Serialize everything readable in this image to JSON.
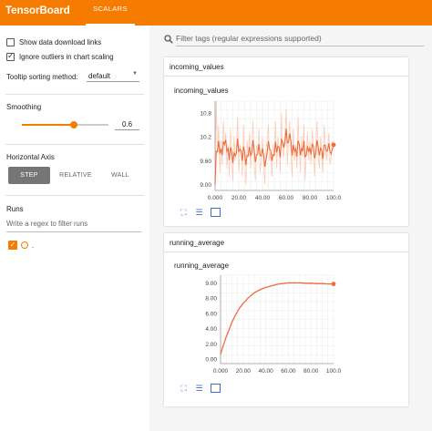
{
  "header": {
    "brand": "TensorBoard",
    "tabs": [
      {
        "label": "SCALARS",
        "active": true
      }
    ]
  },
  "sidebar": {
    "show_download": {
      "label": "Show data download links",
      "checked": false
    },
    "ignore_outliers": {
      "label": "Ignore outliers in chart scaling",
      "checked": true
    },
    "tooltip_sort": {
      "label": "Tooltip sorting method:",
      "value": "default"
    },
    "smoothing": {
      "title": "Smoothing",
      "value": "0.6",
      "fraction": 0.6
    },
    "horizontal_axis": {
      "title": "Horizontal Axis",
      "options": [
        "STEP",
        "RELATIVE",
        "WALL"
      ],
      "selected": "STEP"
    },
    "runs": {
      "title": "Runs",
      "placeholder": "Write a regex to filter runs",
      "items": [
        {
          "name": ".",
          "checked": true
        }
      ]
    }
  },
  "main": {
    "filter_placeholder": "Filter tags (regular expressions supported)"
  },
  "colors": {
    "accent": "#f57c00",
    "line": "#f26b38",
    "line_raw": "#f9b89a"
  },
  "icons": [
    "search-icon",
    "fit-domain-icon",
    "log-scale-icon",
    "expand-icon"
  ],
  "chart_data": [
    {
      "type": "line",
      "card_title": "incoming_values",
      "title": "incoming_values",
      "xlim": [
        0,
        100
      ],
      "ylim": [
        8.85,
        11.1
      ],
      "x_ticks": [
        "0.000",
        "20.00",
        "40.00",
        "60.00",
        "80.00",
        "100.0"
      ],
      "y_ticks": [
        "9.00",
        "9.60",
        "10.2",
        "10.8"
      ],
      "x_tick_values": [
        0,
        20,
        40,
        60,
        80,
        100
      ],
      "y_tick_values": [
        9.0,
        9.6,
        10.2,
        10.8
      ],
      "grid": true,
      "series": [
        {
          "x": [
            0,
            1,
            2,
            3,
            4,
            5,
            6,
            7,
            8,
            9,
            10,
            11,
            12,
            13,
            14,
            15,
            16,
            17,
            18,
            19,
            20,
            21,
            22,
            23,
            24,
            25,
            26,
            27,
            28,
            29,
            30,
            31,
            32,
            33,
            34,
            35,
            36,
            37,
            38,
            39,
            40,
            41,
            42,
            43,
            44,
            45,
            46,
            47,
            48,
            49,
            50,
            51,
            52,
            53,
            54,
            55,
            56,
            57,
            58,
            59,
            60,
            61,
            62,
            63,
            64,
            65,
            66,
            67,
            68,
            69,
            70,
            71,
            72,
            73,
            74,
            75,
            76,
            77,
            78,
            79,
            80,
            81,
            82,
            83,
            84,
            85,
            86,
            87,
            88,
            89,
            90,
            91,
            92,
            93,
            94,
            95,
            96,
            97,
            98,
            99,
            100
          ],
          "y": [
            9.0,
            11.1,
            9.8,
            10.5,
            9.3,
            10.1,
            9.5,
            10.6,
            9.9,
            10.3,
            9.4,
            10.0,
            9.2,
            10.4,
            9.7,
            9.1,
            10.2,
            9.6,
            9.9,
            10.7,
            9.3,
            10.0,
            9.8,
            9.2,
            10.5,
            9.6,
            9.0,
            10.1,
            9.7,
            10.3,
            9.4,
            9.9,
            10.6,
            9.5,
            9.1,
            10.0,
            9.8,
            10.4,
            9.3,
            9.7,
            10.2,
            9.5,
            9.0,
            9.9,
            10.1,
            10.5,
            9.6,
            9.8,
            9.2,
            10.0,
            9.7,
            10.6,
            9.4,
            10.2,
            9.9,
            9.3,
            10.8,
            10.0,
            9.7,
            10.3,
            10.9,
            9.5,
            10.1,
            10.6,
            9.8,
            9.2,
            10.4,
            9.6,
            10.0,
            9.4,
            10.7,
            9.9,
            9.3,
            10.2,
            9.7,
            10.5,
            9.1,
            9.8,
            10.3,
            9.6,
            10.1,
            9.5,
            10.4,
            9.9,
            9.2,
            10.0,
            10.6,
            9.7,
            9.4,
            10.2,
            9.8,
            9.3,
            10.5,
            10.0,
            9.6,
            9.9,
            10.3,
            9.5,
            9.7,
            10.1,
            10.0
          ]
        }
      ]
    },
    {
      "type": "line",
      "card_title": "running_average",
      "title": "running_average",
      "xlim": [
        0,
        100
      ],
      "ylim": [
        -0.6,
        11.0
      ],
      "x_ticks": [
        "0.000",
        "20.00",
        "40.00",
        "60.00",
        "80.00",
        "100.0"
      ],
      "y_ticks": [
        "0.00",
        "2.00",
        "4.00",
        "6.00",
        "8.00",
        "9.00"
      ],
      "x_tick_values": [
        0,
        20,
        40,
        60,
        80,
        100
      ],
      "y_tick_values": [
        0,
        2,
        4,
        6,
        8,
        10
      ],
      "grid": true,
      "series": [
        {
          "x": [
            0,
            2,
            5,
            8,
            10,
            13,
            16,
            20,
            25,
            30,
            35,
            40,
            45,
            50,
            55,
            60,
            65,
            70,
            75,
            80,
            85,
            90,
            95,
            100
          ],
          "y": [
            0.6,
            1.6,
            2.9,
            4.0,
            4.8,
            5.7,
            6.5,
            7.3,
            8.1,
            8.7,
            9.1,
            9.4,
            9.6,
            9.8,
            9.9,
            10.0,
            10.0,
            10.0,
            9.95,
            9.95,
            9.9,
            9.9,
            9.85,
            9.85
          ]
        }
      ]
    }
  ]
}
